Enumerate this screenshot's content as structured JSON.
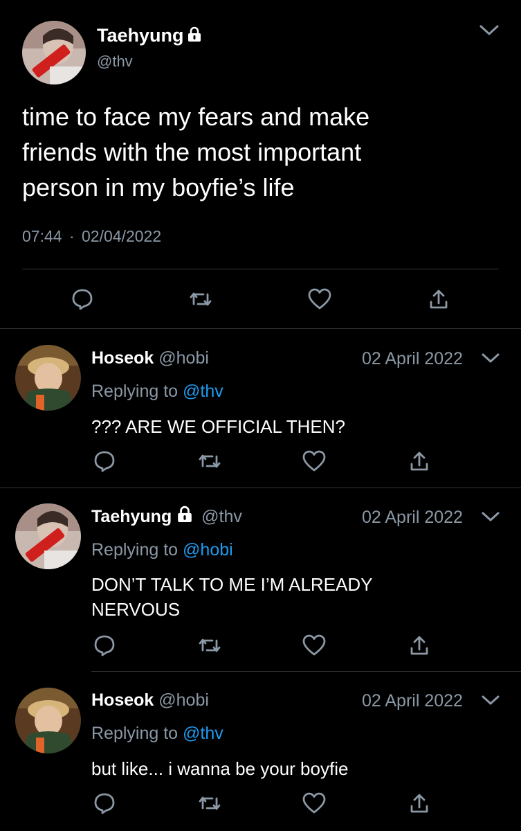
{
  "main_tweet": {
    "display_name": "Taehyung",
    "handle": "@thv",
    "avatar_icon": "user-avatar-taehyung",
    "text_lines": [
      "time to face my fears and make",
      "friends with the most important",
      "person in my boyfie’s life"
    ],
    "time": "07:44",
    "separator": "·",
    "date": "02/04/2022"
  },
  "replies": [
    {
      "display_name": "Hoseok",
      "handle": "@hobi",
      "date": "02 April 2022",
      "replying_prefix": "Replying to",
      "replying_handle": "@thv",
      "text_lines": [
        "??? ARE WE OFFICIAL THEN?"
      ],
      "locked": false
    },
    {
      "display_name": "Taehyung",
      "handle": "@thv",
      "date": "02 April 2022",
      "replying_prefix": "Replying to",
      "replying_handle": "@hobi",
      "text_lines": [
        "DON’T TALK TO ME I’M ALREADY",
        "NERVOUS"
      ],
      "locked": true
    },
    {
      "display_name": "Hoseok",
      "handle": "@hobi",
      "date": "02 April 2022",
      "replying_prefix": "Replying to",
      "replying_handle": "@thv",
      "text_lines": [
        "but like... i wanna be your boyfie"
      ],
      "locked": false
    }
  ],
  "icons": {
    "reply": "comment-icon",
    "retweet": "retweet-icon",
    "like": "heart-icon",
    "share": "share-icon",
    "more": "chevron-down-icon",
    "lock": "lock-icon"
  },
  "colors": {
    "background": "#000000",
    "text": "#ffffff",
    "secondary": "#8b98a5",
    "link": "#1d9bf0",
    "divider": "#2f3336"
  }
}
